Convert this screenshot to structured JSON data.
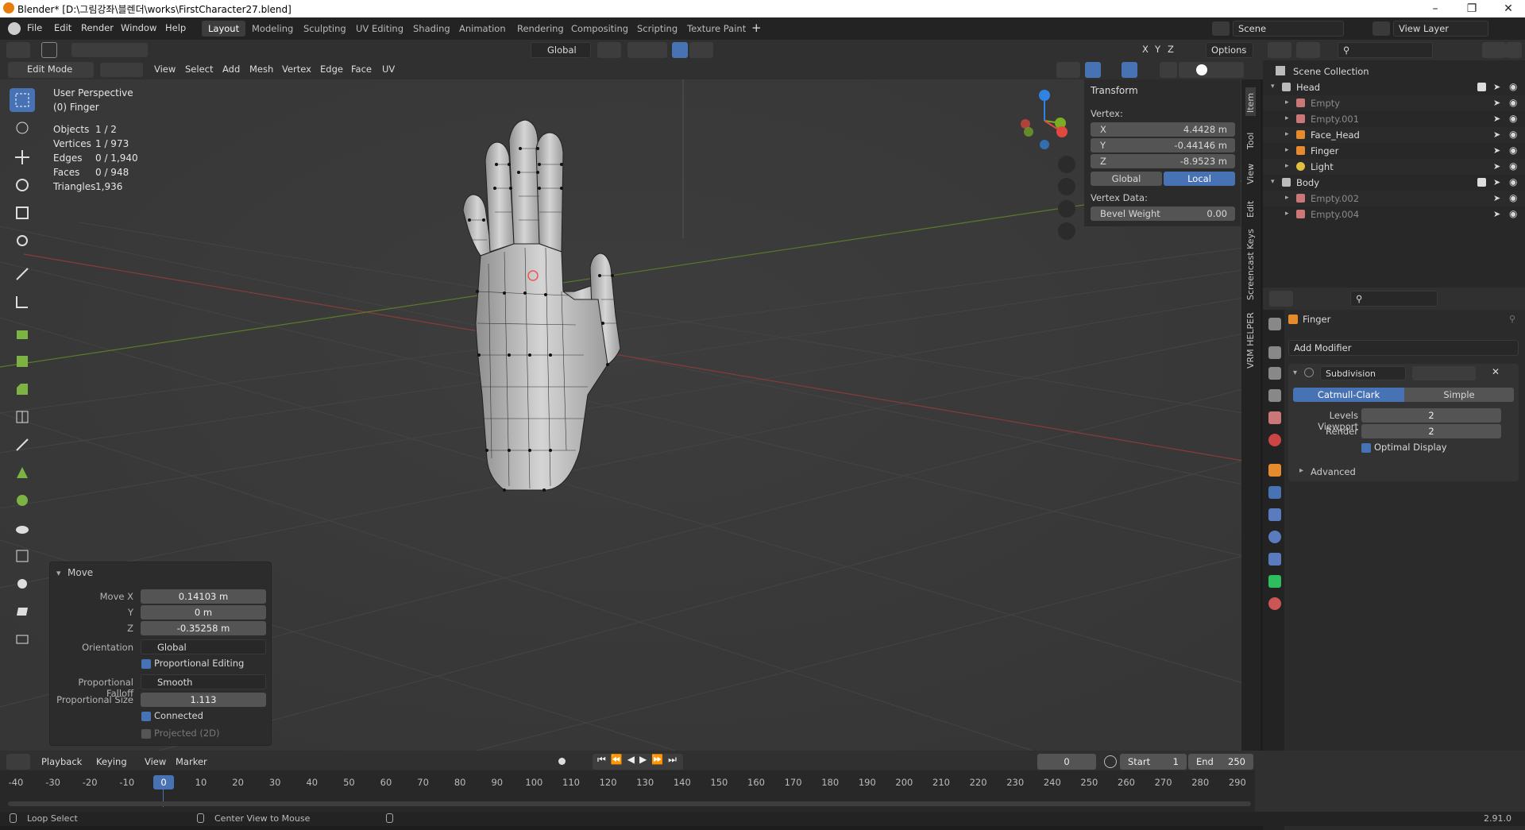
{
  "window": {
    "title": "Blender* [D:\\그림강좌\\블렌더\\works\\FirstCharacter27.blend]"
  },
  "menu": [
    "File",
    "Edit",
    "Render",
    "Window",
    "Help"
  ],
  "workspaces": [
    "Layout",
    "Modeling",
    "Sculpting",
    "UV Editing",
    "Shading",
    "Animation",
    "Rendering",
    "Compositing",
    "Scripting",
    "Texture Paint"
  ],
  "active_workspace": "Layout",
  "scene": {
    "label": "Scene",
    "view_layer": "View Layer"
  },
  "header": {
    "transform_orientation": "Global",
    "axes": [
      "X",
      "Y",
      "Z"
    ],
    "options": "Options",
    "mode": "Edit Mode",
    "menus": [
      "View",
      "Select",
      "Add",
      "Mesh",
      "Vertex",
      "Edge",
      "Face",
      "UV"
    ]
  },
  "overlay": {
    "perspective": "User Perspective",
    "object": "(0) Finger",
    "stats": [
      {
        "label": "Objects",
        "value": "1 / 2"
      },
      {
        "label": "Vertices",
        "value": "1 / 973"
      },
      {
        "label": "Edges",
        "value": "0 / 1,940"
      },
      {
        "label": "Faces",
        "value": "0 / 948"
      },
      {
        "label": "Triangles",
        "value": "1,936"
      }
    ]
  },
  "move_panel": {
    "title": "Move",
    "move_x_label": "Move X",
    "move_x": "0.14103 m",
    "y_label": "Y",
    "y": "0 m",
    "z_label": "Z",
    "z": "-0.35258 m",
    "orientation_label": "Orientation",
    "orientation": "Global",
    "proportional_editing": "Proportional Editing",
    "falloff_label": "Proportional Falloff",
    "falloff": "Smooth",
    "size_label": "Proportional Size",
    "size": "1.113",
    "connected": "Connected",
    "projected": "Projected (2D)"
  },
  "n_panel": {
    "section": "Transform",
    "vertex_label": "Vertex:",
    "x_label": "X",
    "x": "4.4428 m",
    "y_label": "Y",
    "y": "-0.44146 m",
    "z_label": "Z",
    "z": "-8.9523 m",
    "global": "Global",
    "local": "Local",
    "vertex_data": "Vertex Data:",
    "bevel_label": "Bevel Weight",
    "bevel": "0.00"
  },
  "side_tabs": [
    "Item",
    "Tool",
    "View",
    "Edit",
    "Screencast Keys",
    "VRM HELPER"
  ],
  "outliner": {
    "root": "Scene Collection",
    "rows": [
      {
        "name": "Head",
        "level": 1,
        "type": "collection"
      },
      {
        "name": "Empty",
        "level": 2,
        "type": "empty"
      },
      {
        "name": "Empty.001",
        "level": 2,
        "type": "empty"
      },
      {
        "name": "Face_Head",
        "level": 2,
        "type": "mesh"
      },
      {
        "name": "Finger",
        "level": 2,
        "type": "mesh"
      },
      {
        "name": "Light",
        "level": 2,
        "type": "light"
      },
      {
        "name": "Body",
        "level": 1,
        "type": "collection"
      },
      {
        "name": "Empty.002",
        "level": 2,
        "type": "empty"
      },
      {
        "name": "Empty.004",
        "level": 2,
        "type": "empty"
      }
    ]
  },
  "properties": {
    "object": "Finger",
    "add_modifier": "Add Modifier",
    "modifier": "Subdivision",
    "tab_a": "Catmull-Clark",
    "tab_b": "Simple",
    "levels_label": "Levels Viewport",
    "levels": "2",
    "render_label": "Render",
    "render": "2",
    "optimal": "Optimal Display",
    "advanced": "Advanced"
  },
  "timeline": {
    "menus": [
      "Playback",
      "Keying",
      "View",
      "Marker"
    ],
    "current": "0",
    "start_label": "Start",
    "start": "1",
    "end_label": "End",
    "end": "250",
    "ticks": [
      "-40",
      "-30",
      "-20",
      "-10",
      "0",
      "10",
      "20",
      "30",
      "40",
      "50",
      "60",
      "70",
      "80",
      "90",
      "100",
      "110",
      "120",
      "130",
      "140",
      "150",
      "160",
      "170",
      "180",
      "190",
      "200",
      "210",
      "220",
      "230",
      "240",
      "250",
      "260",
      "270",
      "280",
      "290"
    ]
  },
  "status": {
    "left": "Loop Select",
    "middle": "Center View to Mouse",
    "version": "2.91.0"
  },
  "colors": {
    "accent": "#4772b3",
    "x_axis": "#e3483f",
    "y_axis": "#7bad23",
    "z_axis": "#2f84e3",
    "mesh": "#b4b4b4"
  }
}
